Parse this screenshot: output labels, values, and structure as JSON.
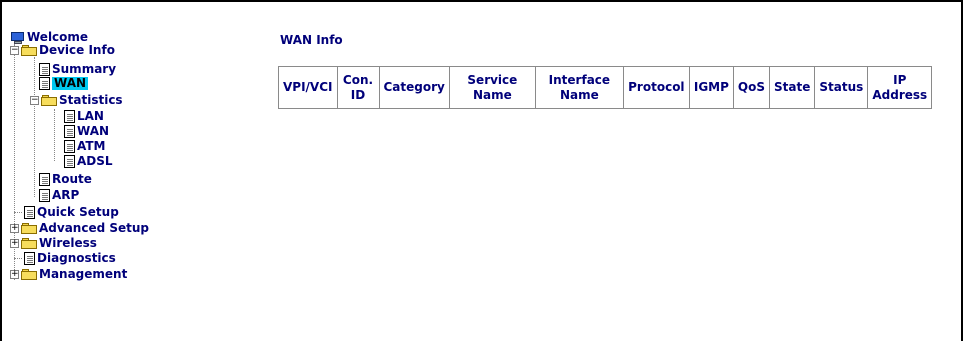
{
  "nav": {
    "welcome": "Welcome",
    "device_info": "Device Info",
    "summary": "Summary",
    "wan": "WAN",
    "statistics": "Statistics",
    "stat_lan": "LAN",
    "stat_wan": "WAN",
    "stat_atm": "ATM",
    "stat_adsl": "ADSL",
    "route": "Route",
    "arp": "ARP",
    "quick_setup": "Quick Setup",
    "advanced_setup": "Advanced Setup",
    "wireless": "Wireless",
    "diagnostics": "Diagnostics",
    "management": "Management",
    "expanded_glyph": "−",
    "collapsed_glyph": "+"
  },
  "main": {
    "title": "WAN Info",
    "columns": [
      [
        "VPI/VCI"
      ],
      [
        "Con.",
        "ID"
      ],
      [
        "Category"
      ],
      [
        "Service",
        "Name"
      ],
      [
        "Interface",
        "Name"
      ],
      [
        "Protocol"
      ],
      [
        "IGMP"
      ],
      [
        "QoS"
      ],
      [
        "State"
      ],
      [
        "Status"
      ],
      [
        "IP",
        "Address"
      ]
    ]
  },
  "colors": {
    "link": "#00007a",
    "selected_bg": "#00c8f0"
  }
}
